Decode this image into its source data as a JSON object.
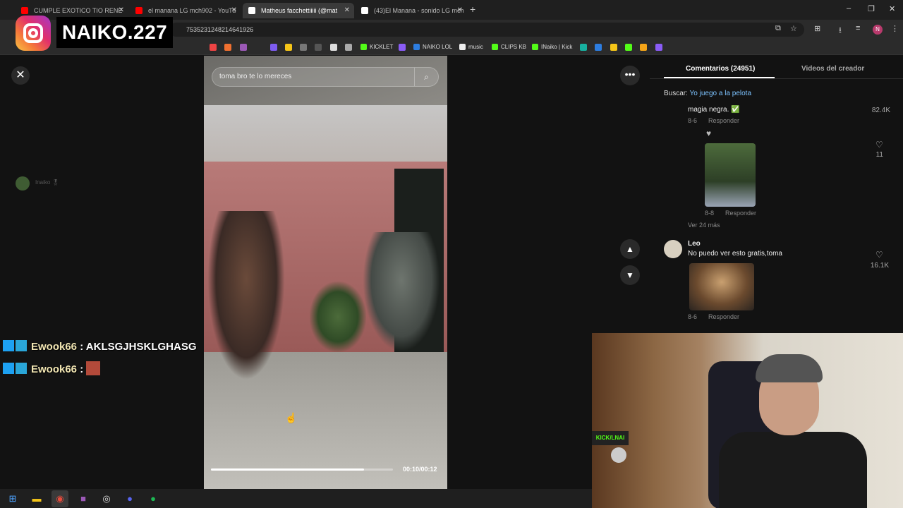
{
  "browser": {
    "tabs": [
      {
        "title": "CUMPLE EXOTICO TIO RENE",
        "favicon_color": "#ff0000"
      },
      {
        "title": "el manana LG mch902 - YouTu",
        "favicon_color": "#ff0000"
      },
      {
        "title": "Matheus facchettiiiii (@mat",
        "favicon_color": "#ffffff"
      },
      {
        "title": "(43)El Manana - sonido LG mch",
        "favicon_color": "#ffffff"
      }
    ],
    "new_tab_label": "+",
    "url": "7535231248214641926",
    "window_controls": {
      "minimize": "–",
      "maximize": "❐",
      "close": "✕"
    },
    "profile_initial": "N",
    "bookmarks": [
      "KICKLET",
      "NAIKO LOL",
      "music",
      "CLIPS KB",
      "INaiko | Kick"
    ]
  },
  "overlay": {
    "streamer_name": "NAIKO.227"
  },
  "left_panel": {
    "close_label": "✕",
    "side_name": "Inaiko 🎖",
    "chat": [
      {
        "user": "Ewook66",
        "message": ": AKLSGJHSKLGHASG"
      },
      {
        "user": "Ewook66",
        "message": ":"
      }
    ]
  },
  "video": {
    "search_placeholder": "toma bro te lo mereces",
    "current_time": "00:10",
    "total_time": "00:12",
    "time_display": "00:10/00:12",
    "progress_fraction": 0.84
  },
  "controls": {
    "more_label": "•••",
    "up_label": "▲",
    "down_label": "▼"
  },
  "comments_panel": {
    "tab_comments": "Comentarios (24951)",
    "tab_videos": "Videos del creador",
    "search_label": "Buscar:",
    "search_link": "Yo juego a la pelota",
    "items": [
      {
        "text": "magia negra. ✅",
        "date": "8-6",
        "reply": "Responder",
        "likes": "82.4K"
      },
      {
        "date": "8-8",
        "reply": "Responder",
        "likes": "11"
      },
      {
        "more": "Ver 24 más"
      },
      {
        "user": "Leo",
        "text": "No puedo ver esto gratis,toma",
        "date": "8-6",
        "reply": "Responder",
        "likes": "16.1K"
      }
    ]
  },
  "webcam": {
    "kick_label": "KICK/LNAI"
  }
}
